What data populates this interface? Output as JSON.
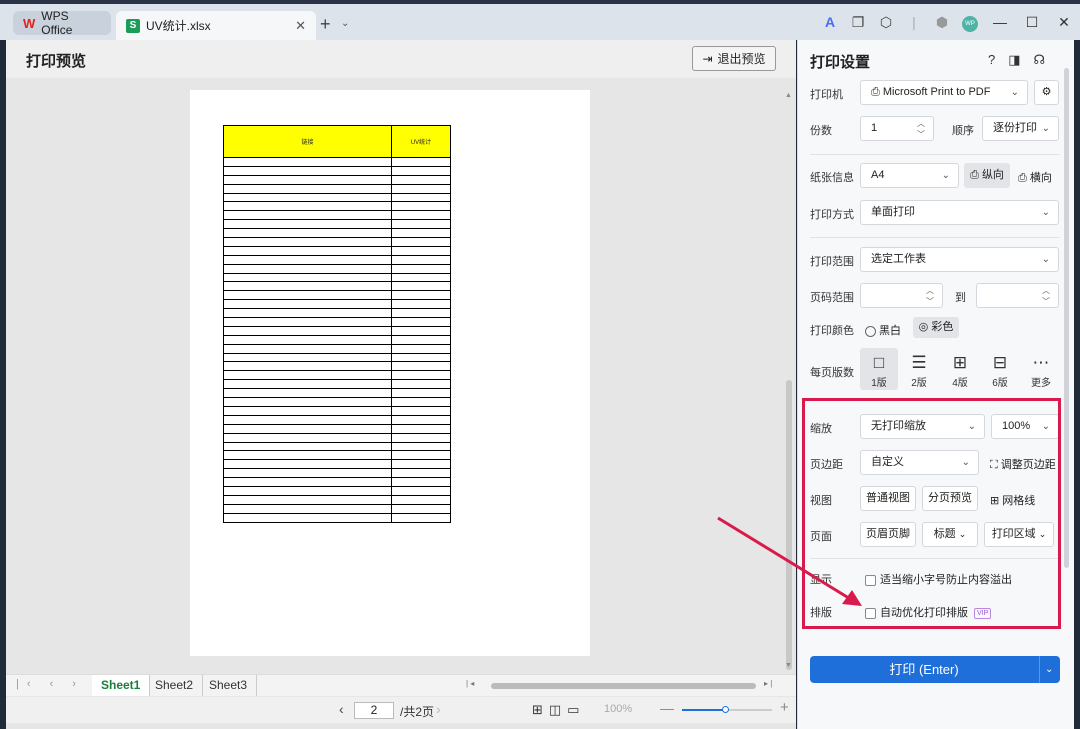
{
  "titlebar": {
    "tab_wps": "WPS Office",
    "tab_file": "UV统计.xlsx",
    "avatar_text": "WP"
  },
  "preview": {
    "title": "打印预览",
    "exit_label": "退出预览",
    "table_header": [
      "链接",
      "UV统计"
    ],
    "empty_rows": 41
  },
  "sheets": [
    "Sheet1",
    "Sheet2",
    "Sheet3"
  ],
  "status": {
    "page_current": "2",
    "page_total": "/共2页",
    "zoom": "100%"
  },
  "panel": {
    "title": "打印设置",
    "printer_label": "打印机",
    "printer_value": "Microsoft Print to PDF",
    "copies_label": "份数",
    "copies_value": "1",
    "order_label": "顺序",
    "order_value": "逐份打印",
    "paper_label": "纸张信息",
    "paper_value": "A4",
    "portrait_label": "纵向",
    "landscape_label": "横向",
    "mode_label": "打印方式",
    "mode_value": "单面打印",
    "range_label": "打印范围",
    "range_value": "选定工作表",
    "pages_label": "页码范围",
    "to_label": "到",
    "color_label": "打印颜色",
    "bw_label": "黑白",
    "color_value_label": "彩色",
    "layout_label": "每页版数",
    "layouts": [
      "1版",
      "2版",
      "4版",
      "6版",
      "更多"
    ],
    "scale_label": "缩放",
    "scale_value": "无打印缩放",
    "scale_pct": "100%",
    "margin_label": "页边距",
    "margin_value": "自定义",
    "adjust_margin_label": "调整页边距",
    "view_label": "视图",
    "normal_view_label": "普通视图",
    "page_break_label": "分页预览",
    "gridlines_label": "网格线",
    "page_label": "页面",
    "header_footer_label": "页眉页脚",
    "titles_label": "标题",
    "print_area_label": "打印区域",
    "display_label": "显示",
    "shrink_option": "适当缩小字号防止内容溢出",
    "typeset_label": "排版",
    "auto_optimize_option": "自动优化打印排版",
    "vip_badge": "VIP",
    "print_button": "打印 (Enter)"
  },
  "colors": {
    "accent": "#1e6fd9",
    "highlight": "#d81b4c",
    "header_fill": "#ffff00"
  }
}
